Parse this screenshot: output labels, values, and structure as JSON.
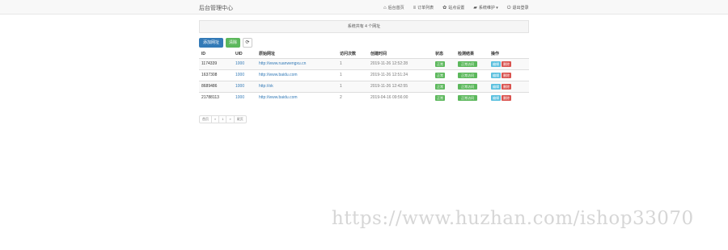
{
  "navbar": {
    "brand": "后台管理中心",
    "items": [
      {
        "icon": "⌂",
        "label": "后台首页"
      },
      {
        "icon": "≡",
        "label": "订单列表"
      },
      {
        "icon": "✿",
        "label": "站点设置"
      },
      {
        "icon": "▰",
        "label": "系统维护 ▾"
      },
      {
        "icon": "⏻",
        "label": "退出登录"
      }
    ]
  },
  "notice": "系统共有 4 个网址",
  "buttons": {
    "add": "添加网址",
    "clear": "清除",
    "refresh_icon": "⟳"
  },
  "table": {
    "headers": [
      "ID",
      "UID",
      "原始网址",
      "访问次数",
      "创建时间",
      "状态",
      "检测结果",
      "操作"
    ],
    "rows": [
      {
        "id": "1174339",
        "uid": "1000",
        "url": "http://www.ruanwengxu.cn",
        "visits": "1",
        "time": "2019-11-26 12:52:28",
        "status": "正常",
        "check": "正常访问",
        "edit": "编辑",
        "del": "删除"
      },
      {
        "id": "1637308",
        "uid": "1000",
        "url": "http://www.baidu.com",
        "visits": "1",
        "time": "2019-11-26 12:51:24",
        "status": "正常",
        "check": "正常访问",
        "edit": "编辑",
        "del": "删除"
      },
      {
        "id": "8689486",
        "uid": "1000",
        "url": "http://ok",
        "visits": "1",
        "time": "2019-11-26 12:42:55",
        "status": "正常",
        "check": "正常访问",
        "edit": "编辑",
        "del": "删除"
      },
      {
        "id": "21788113",
        "uid": "1000",
        "url": "http://www.baidu.com",
        "visits": "2",
        "time": "2019-04-16 09:56:00",
        "status": "正常",
        "check": "正常访问",
        "edit": "编辑",
        "del": "删除"
      }
    ]
  },
  "pagination": [
    "首页",
    "«",
    "1",
    "»",
    "尾页"
  ],
  "watermark": "https://www.huzhan.com/ishop33070"
}
